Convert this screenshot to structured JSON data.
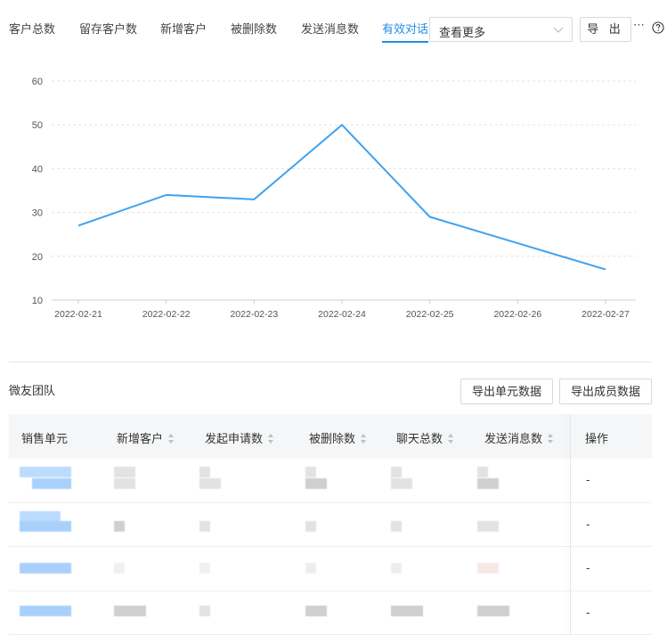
{
  "tabs": [
    {
      "label": "客户总数",
      "active": false
    },
    {
      "label": "留存客户数",
      "active": false
    },
    {
      "label": "新增客户",
      "active": false
    },
    {
      "label": "被删除数",
      "active": false
    },
    {
      "label": "发送消息数",
      "active": false
    },
    {
      "label": "有效对话",
      "active": true
    }
  ],
  "select": {
    "value": "查看更多",
    "icon": "chevron-down-icon"
  },
  "toolbar": {
    "export_label": "导 出",
    "more_icon": "more-icon",
    "help_icon": "help-icon"
  },
  "chart_data": {
    "type": "line",
    "x": [
      "2022-02-21",
      "2022-02-22",
      "2022-02-23",
      "2022-02-24",
      "2022-02-25",
      "2022-02-26",
      "2022-02-27"
    ],
    "series": [
      {
        "values": [
          27,
          34,
          33,
          50,
          29,
          23,
          17
        ],
        "color": "#3da2f0"
      }
    ],
    "ylim": [
      10,
      60
    ],
    "yticks": [
      10,
      20,
      30,
      40,
      50,
      60
    ],
    "grid": true,
    "title": "",
    "xlabel": "",
    "ylabel": ""
  },
  "team": {
    "title": "微友团队",
    "export_unit_label": "导出单元数据",
    "export_member_label": "导出成员数据"
  },
  "table": {
    "columns": [
      {
        "label": "销售单元",
        "sortable": false
      },
      {
        "label": "新增客户",
        "sortable": true
      },
      {
        "label": "发起申请数",
        "sortable": true
      },
      {
        "label": "被删除数",
        "sortable": true
      },
      {
        "label": "聊天总数",
        "sortable": true
      },
      {
        "label": "发送消息数",
        "sortable": true
      },
      {
        "label": "操作",
        "sortable": false
      }
    ],
    "rows": [
      {
        "operation": "-"
      },
      {
        "operation": "-"
      },
      {
        "operation": "-"
      },
      {
        "operation": "-"
      }
    ]
  }
}
